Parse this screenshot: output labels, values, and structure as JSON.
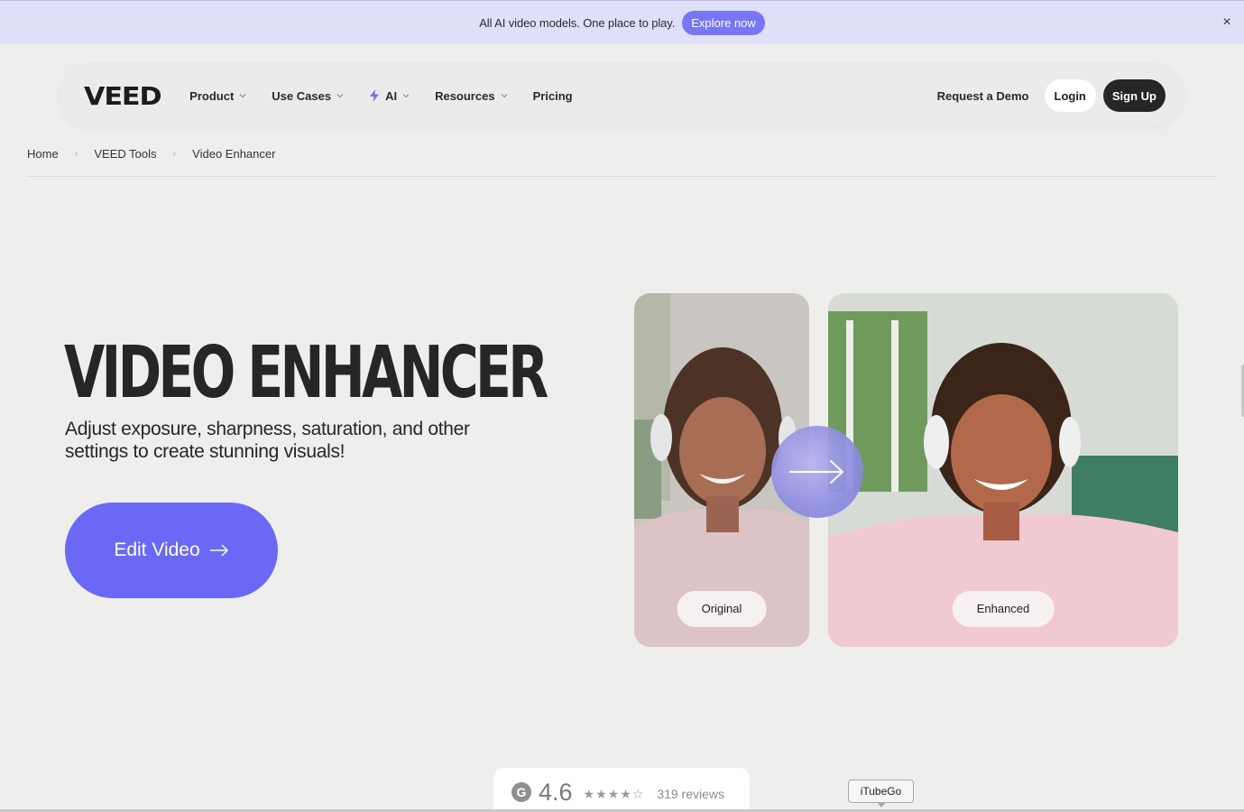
{
  "banner": {
    "text": "All AI video models. One place to play.",
    "button_label": "Explore now",
    "close_symbol": "×",
    "accent_color": "#7a75f5"
  },
  "nav": {
    "logo": "VEED",
    "items": [
      {
        "label": "Product",
        "has_dropdown": true
      },
      {
        "label": "Use Cases",
        "has_dropdown": true
      },
      {
        "label": "AI",
        "has_dropdown": true,
        "icon": "lightning-bolt-icon"
      },
      {
        "label": "Resources",
        "has_dropdown": true
      },
      {
        "label": "Pricing",
        "has_dropdown": false
      }
    ],
    "request_demo": "Request a Demo",
    "login": "Login",
    "signup": "Sign Up"
  },
  "breadcrumb": {
    "items": [
      "Home",
      "VEED Tools",
      "Video Enhancer"
    ],
    "separator": "›"
  },
  "hero": {
    "title": "VIDEO ENHANCER",
    "subtitle": "Adjust exposure, sharpness, saturation, and other settings to create stunning visuals!",
    "cta_label": "Edit Video",
    "cta_color": "#6a68f5"
  },
  "comparison": {
    "original_label": "Original",
    "enhanced_label": "Enhanced"
  },
  "rating": {
    "score": "4.6",
    "stars": "★★★★☆",
    "reviews": "319 reviews",
    "icon": "g2-icon"
  },
  "tooltip": {
    "text": "iTubeGo"
  }
}
